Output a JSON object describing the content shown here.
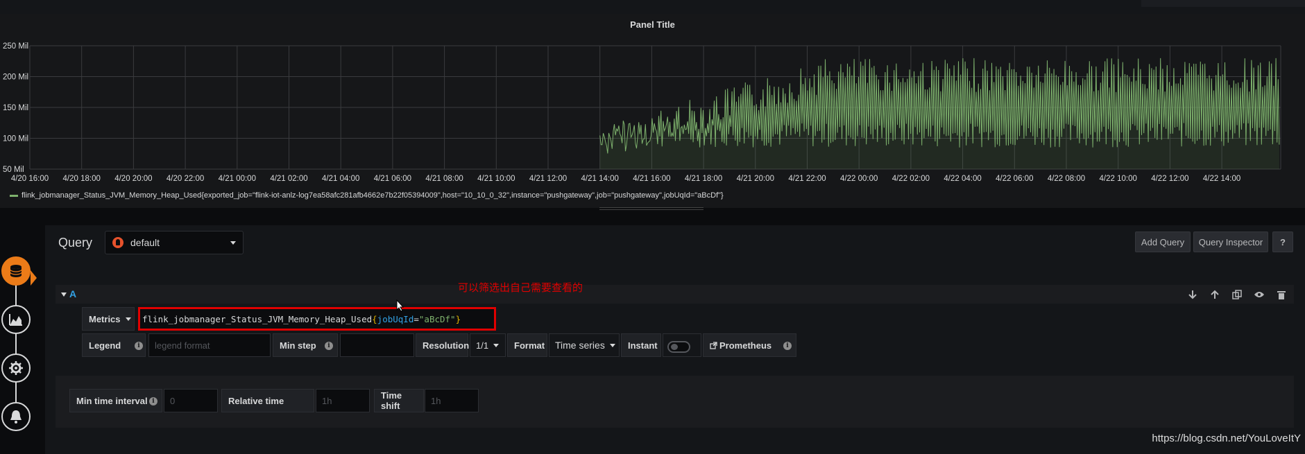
{
  "panel": {
    "title": "Panel Title",
    "legend": "flink_jobmanager_Status_JVM_Memory_Heap_Used{exported_job=\"flink-iot-anlz-log7ea58afc281afb4662e7b22f05394009\",host=\"10_10_0_32\",instance=\"pushgateway\",job=\"pushgateway\",jobUqId=\"aBcDf\"}"
  },
  "chart_data": {
    "type": "line",
    "series": [
      {
        "name": "flink_jobmanager_Status_JVM_Memory_Heap_Used{exported_job=\"flink-iot-anlz-log7ea58afc281afb4662e7b22f05394009\",host=\"10_10_0_32\",instance=\"pushgateway\",job=\"pushgateway\",jobUqId=\"aBcDf\"}",
        "color": "#7eb26d",
        "data_start": "4/21 14:00",
        "min": 60,
        "max": 230
      }
    ],
    "x_ticks": [
      "4/20 16:00",
      "4/20 18:00",
      "4/20 20:00",
      "4/20 22:00",
      "4/21 00:00",
      "4/21 02:00",
      "4/21 04:00",
      "4/21 06:00",
      "4/21 08:00",
      "4/21 10:00",
      "4/21 12:00",
      "4/21 14:00",
      "4/21 16:00",
      "4/21 18:00",
      "4/21 20:00",
      "4/21 22:00",
      "4/22 00:00",
      "4/22 02:00",
      "4/22 04:00",
      "4/22 06:00",
      "4/22 08:00",
      "4/22 10:00",
      "4/22 12:00",
      "4/22 14:00"
    ],
    "y_ticks": [
      "250 Mil",
      "200 Mil",
      "150 Mil",
      "100 Mil",
      "50 Mil"
    ],
    "ylim": [
      50,
      250
    ],
    "grid": true
  },
  "editor": {
    "query_label": "Query",
    "datasource": "default",
    "add_query": "Add Query",
    "query_inspector": "Query Inspector",
    "help": "?",
    "row_letter": "A",
    "annotation": "可以筛选出自己需要查看的",
    "metrics_label": "Metrics",
    "metrics_expr": {
      "metric": "flink_jobmanager_Status_JVM_Memory_Heap_Used",
      "open": "{",
      "key": "jobUqId",
      "op": "=",
      "value": "\"aBcDf\"",
      "close": "}"
    },
    "legend_label": "Legend",
    "legend_placeholder": "legend format",
    "min_step_label": "Min step",
    "min_step_value": "",
    "resolution_label": "Resolution",
    "resolution_value": "1/1",
    "format_label": "Format",
    "format_value": "Time series",
    "instant_label": "Instant",
    "instant_on": false,
    "prometheus_link": "Prometheus"
  },
  "options": {
    "min_time_interval_label": "Min time interval",
    "min_time_interval_placeholder": "0",
    "relative_time_label": "Relative time",
    "relative_time_placeholder": "1h",
    "time_shift_label": "Time shift",
    "time_shift_placeholder": "1h"
  },
  "watermark": "https://blog.csdn.net/YouLoveItY"
}
